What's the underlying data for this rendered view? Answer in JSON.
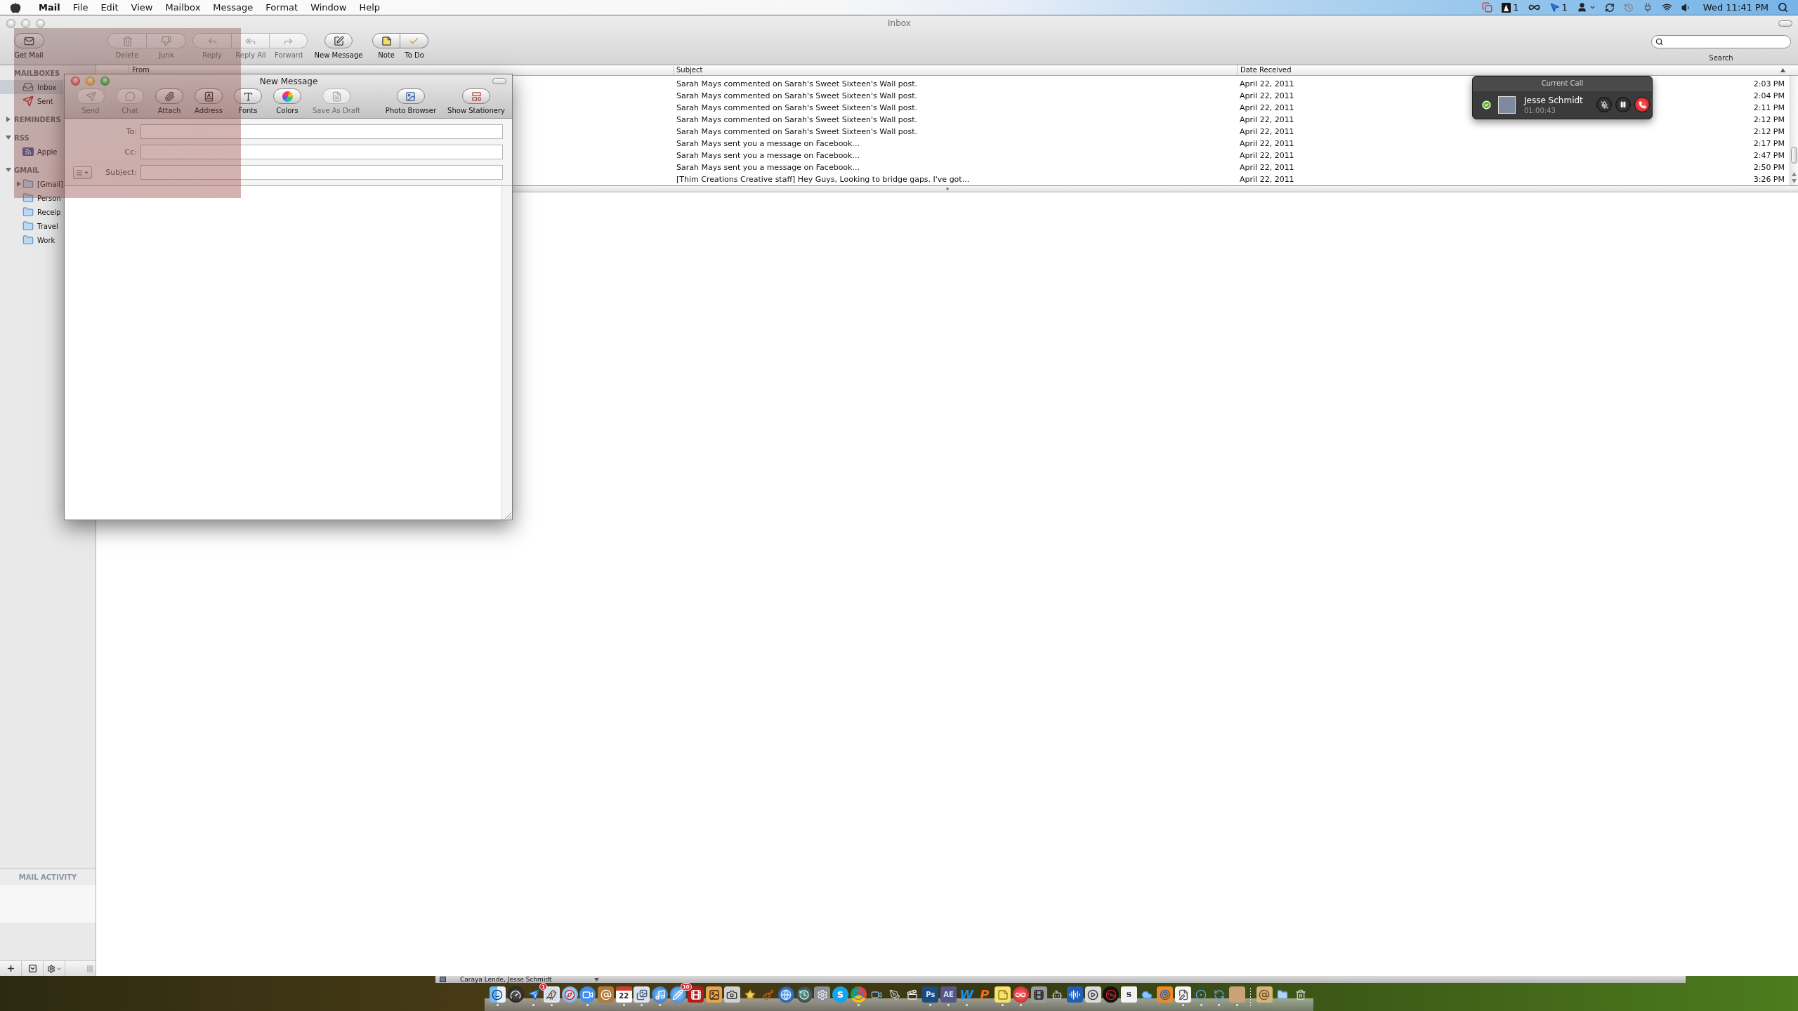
{
  "menu_bar": {
    "app": "Mail",
    "menus": [
      "File",
      "Edit",
      "View",
      "Mailbox",
      "Message",
      "Format",
      "Window",
      "Help"
    ],
    "status_items": [
      {
        "kind": "screens"
      },
      {
        "kind": "updater",
        "text": "1"
      },
      {
        "kind": "loop"
      },
      {
        "kind": "pointer",
        "text": "1"
      },
      {
        "kind": "user"
      },
      {
        "kind": "sync"
      },
      {
        "kind": "time-machine"
      },
      {
        "kind": "plug"
      },
      {
        "kind": "wifi"
      },
      {
        "kind": "volume"
      }
    ],
    "clock": "Wed 11:41 PM"
  },
  "window": {
    "title": "Inbox",
    "active": false
  },
  "toolbar": {
    "groups": [
      {
        "buttons": [
          {
            "kind": "get-mail",
            "label": "Get Mail",
            "disabled": false
          }
        ]
      },
      {
        "buttons": [
          {
            "kind": "delete",
            "label": "Delete",
            "disabled": true
          },
          {
            "kind": "junk",
            "label": "Junk",
            "disabled": true
          }
        ]
      },
      {
        "buttons": [
          {
            "kind": "reply",
            "label": "Reply",
            "disabled": true
          },
          {
            "kind": "reply-all",
            "label": "Reply All",
            "disabled": true
          },
          {
            "kind": "forward",
            "label": "Forward",
            "disabled": true
          }
        ]
      },
      {
        "buttons": [
          {
            "kind": "new-message",
            "label": "New Message",
            "disabled": false
          }
        ]
      },
      {
        "buttons": [
          {
            "kind": "note",
            "label": "Note",
            "disabled": false
          },
          {
            "kind": "todo",
            "label": "To Do",
            "disabled": false
          }
        ]
      }
    ],
    "search": {
      "label": "Search"
    }
  },
  "sidebar": {
    "sections": [
      {
        "title": "MAILBOXES",
        "kind": "fixed",
        "items": [
          {
            "label": "Inbox",
            "kind": "inbox",
            "selected": true
          },
          {
            "label": "Sent",
            "kind": "sent",
            "selected": false
          }
        ]
      },
      {
        "title": "REMINDERS",
        "kind": "disclosure",
        "expanded": false
      },
      {
        "title": "RSS",
        "kind": "disclosure",
        "expanded": true,
        "items": [
          {
            "label": "Apple",
            "kind": "rss",
            "selected": false
          }
        ]
      },
      {
        "title": "GMAIL",
        "kind": "disclosure",
        "expanded": true,
        "items": [
          {
            "label": "[Gmail]",
            "kind": "folder",
            "selected": false,
            "expanded": false
          },
          {
            "label": "Person",
            "kind": "folder",
            "selected": false
          },
          {
            "label": "Receip",
            "kind": "folder",
            "selected": false
          },
          {
            "label": "Travel",
            "kind": "folder",
            "selected": false
          },
          {
            "label": "Work",
            "kind": "folder",
            "selected": false
          }
        ]
      }
    ],
    "activity": {
      "title": "MAIL ACTIVITY"
    },
    "footer": [
      {
        "kind": "add"
      },
      {
        "kind": "mailbox-menu"
      },
      {
        "kind": "action-menu"
      },
      {
        "kind": "grip"
      }
    ]
  },
  "message_list": {
    "columns": [
      {
        "label": "From",
        "sorted": false
      },
      {
        "label": "Subject",
        "sorted": false
      },
      {
        "label": "Date Received",
        "sorted": true
      }
    ],
    "rows": [
      {
        "subject": "Sarah Mays commented on Sarah's Sweet Sixteen's Wall post.",
        "date": "April 22, 2011",
        "time": "2:03 PM",
        "selected": false
      },
      {
        "subject": "Sarah Mays commented on Sarah's Sweet Sixteen's Wall post.",
        "date": "April 22, 2011",
        "time": "2:04 PM",
        "selected": false
      },
      {
        "subject": "Sarah Mays commented on Sarah's Sweet Sixteen's Wall post.",
        "date": "April 22, 2011",
        "time": "2:11 PM",
        "selected": false
      },
      {
        "subject": "Sarah Mays commented on Sarah's Sweet Sixteen's Wall post.",
        "date": "April 22, 2011",
        "time": "2:12 PM",
        "selected": false
      },
      {
        "subject": "Sarah Mays commented on Sarah's Sweet Sixteen's Wall post.",
        "date": "April 22, 2011",
        "time": "2:12 PM",
        "selected": false
      },
      {
        "subject": "Sarah Mays sent you a message on Facebook...",
        "date": "April 22, 2011",
        "time": "2:17 PM",
        "selected": false
      },
      {
        "subject": "Sarah Mays sent you a message on Facebook...",
        "date": "April 22, 2011",
        "time": "2:47 PM",
        "selected": false
      },
      {
        "subject": "Sarah Mays sent you a message on Facebook...",
        "date": "April 22, 2011",
        "time": "2:50 PM",
        "selected": false
      },
      {
        "subject": "[Thim Creations Creative staff] Hey Guys, Looking to bridge gaps. I've got...",
        "date": "April 22, 2011",
        "time": "3:26 PM",
        "selected": false
      }
    ]
  },
  "compose": {
    "title": "New Message",
    "active": true,
    "toolbar": [
      {
        "kind": "send",
        "label": "Send",
        "disabled": true
      },
      {
        "kind": "chat",
        "label": "Chat",
        "disabled": true
      },
      {
        "kind": "attach",
        "label": "Attach",
        "disabled": false
      },
      {
        "kind": "address",
        "label": "Address",
        "disabled": false
      },
      {
        "kind": "fonts",
        "label": "Fonts",
        "disabled": false
      },
      {
        "kind": "colors",
        "label": "Colors",
        "disabled": false
      },
      {
        "kind": "save-draft",
        "label": "Save As Draft",
        "disabled": true
      },
      {
        "kind": "photo-browser",
        "label": "Photo Browser",
        "disabled": false
      },
      {
        "kind": "stationery",
        "label": "Show Stationery",
        "disabled": false
      }
    ],
    "fields": [
      {
        "kind": "address",
        "label": "To:"
      },
      {
        "kind": "address",
        "label": "Cc:"
      },
      {
        "kind": "subject",
        "label": "Subject:"
      }
    ]
  },
  "call": {
    "title": "Current Call",
    "contact": "Jesse Schmidt",
    "duration": "01:00:43"
  },
  "background_window": {
    "title": "Caraya Lende, Jesse Schmidt"
  },
  "dock": {
    "items": [
      {
        "kind": "smiley-tile",
        "running": true
      },
      {
        "kind": "gauge",
        "running": false
      },
      {
        "kind": "paper-plane",
        "badge": "1",
        "running": true
      },
      {
        "kind": "bird-stamp",
        "running": true
      },
      {
        "kind": "compass",
        "running": false
      },
      {
        "kind": "video-bubble",
        "running": true
      },
      {
        "kind": "at-book",
        "running": false
      },
      {
        "kind": "calendar",
        "glyph": "22",
        "running": true
      },
      {
        "kind": "photos",
        "running": true
      },
      {
        "kind": "music-disc",
        "running": true
      },
      {
        "kind": "pencil-disc",
        "badge": "10",
        "running": false
      },
      {
        "kind": "film-tile",
        "running": false
      },
      {
        "kind": "landscape",
        "running": false
      },
      {
        "kind": "camera",
        "running": false
      },
      {
        "kind": "star",
        "running": false
      },
      {
        "kind": "guitar",
        "running": false
      },
      {
        "kind": "globe",
        "running": false
      },
      {
        "kind": "clock-arrow",
        "running": false
      },
      {
        "kind": "gear",
        "running": false
      },
      {
        "kind": "letter-disc",
        "glyph": "S",
        "color": "#12a5ec",
        "running": false
      },
      {
        "kind": "tricolor-disc",
        "running": true
      },
      {
        "kind": "video-camera",
        "running": false
      },
      {
        "kind": "pen-nib",
        "running": false
      },
      {
        "kind": "clapperboard",
        "running": false
      },
      {
        "kind": "letter-tile",
        "glyph": "Ps",
        "color": "#1d4d7e",
        "running": true
      },
      {
        "kind": "letter-tile",
        "glyph": "AE",
        "color": "#58578a",
        "running": true
      },
      {
        "kind": "letter",
        "glyph": "W",
        "color": "#1e8fe8",
        "running": true
      },
      {
        "kind": "letter",
        "glyph": "P",
        "color": "#f26a1b",
        "running": false
      },
      {
        "kind": "sticky-note",
        "running": true
      },
      {
        "kind": "loop-disc",
        "running": true
      },
      {
        "kind": "film-strip",
        "running": false
      },
      {
        "kind": "robot",
        "running": false
      },
      {
        "kind": "audio-bars",
        "running": false
      },
      {
        "kind": "play-tile",
        "running": false
      },
      {
        "kind": "record",
        "running": false
      },
      {
        "kind": "letter-tile",
        "glyph": "S",
        "color": "#f2f2f2",
        "running": false
      },
      {
        "kind": "cloud",
        "running": false
      },
      {
        "kind": "ring-tile",
        "running": false
      },
      {
        "kind": "document-pen",
        "running": true
      },
      {
        "kind": "ring",
        "running": true
      },
      {
        "kind": "circular-arrows",
        "running": true
      },
      {
        "kind": "photo",
        "running": true
      },
      {
        "kind": "separator"
      },
      {
        "kind": "at-tile",
        "running": false
      },
      {
        "kind": "folder",
        "running": false
      },
      {
        "kind": "trash",
        "running": false
      }
    ]
  }
}
